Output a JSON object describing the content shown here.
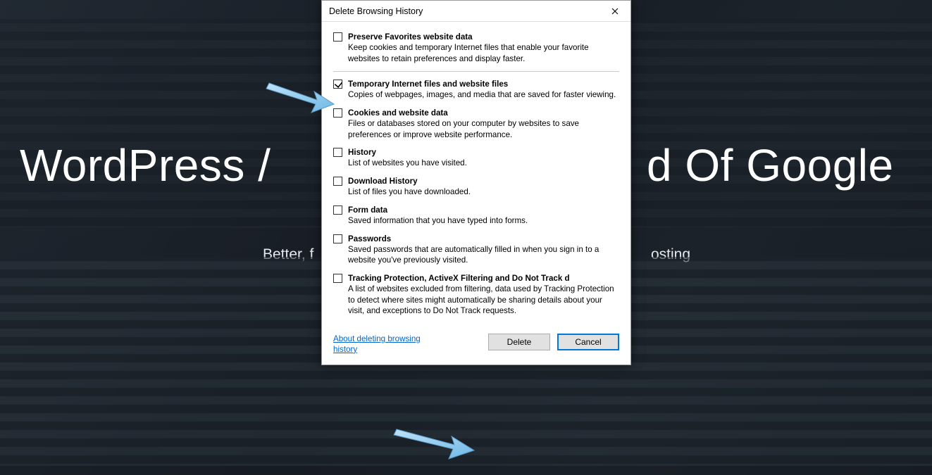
{
  "background": {
    "title_left": "WordPress /",
    "title_right": "d Of Google",
    "subtitle_left": "Better, f",
    "subtitle_right": "osting"
  },
  "dialog": {
    "title": "Delete Browsing History",
    "options": [
      {
        "checked": false,
        "label": "Preserve Favorites website data",
        "desc": "Keep cookies and temporary Internet files that enable your favorite websites to retain preferences and display faster."
      },
      {
        "checked": true,
        "label": "Temporary Internet files and website files",
        "desc": "Copies of webpages, images, and media that are saved for faster viewing."
      },
      {
        "checked": false,
        "label": "Cookies and website data",
        "desc": "Files or databases stored on your computer by websites to save preferences or improve website performance."
      },
      {
        "checked": false,
        "label": "History",
        "desc": "List of websites you have visited."
      },
      {
        "checked": false,
        "label": "Download History",
        "desc": "List of files you have downloaded."
      },
      {
        "checked": false,
        "label": "Form data",
        "desc": "Saved information that you have typed into forms."
      },
      {
        "checked": false,
        "label": "Passwords",
        "desc": "Saved passwords that are automatically filled in when you sign in to a website you've previously visited."
      },
      {
        "checked": false,
        "label": "Tracking Protection, ActiveX Filtering and Do Not Track d",
        "desc": "A list of websites excluded from filtering, data used by Tracking Protection to detect where sites might automatically be sharing details about your visit, and exceptions to Do Not Track requests."
      }
    ],
    "link": "About deleting browsing history",
    "buttons": {
      "delete": "Delete",
      "cancel": "Cancel"
    }
  }
}
